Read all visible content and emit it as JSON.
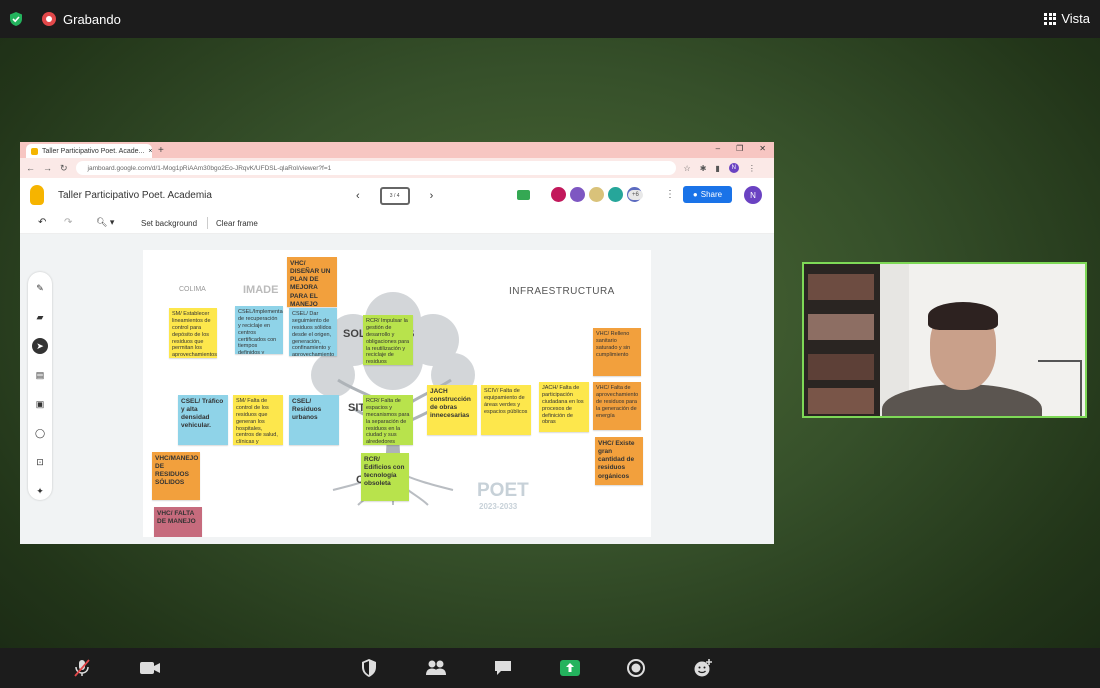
{
  "topbar": {
    "recording_label": "Grabando",
    "view_label": "Vista"
  },
  "browser": {
    "tab_title": "Taller Participativo Poet. Acade...",
    "tab_close": "×",
    "new_tab": "+",
    "url": "jamboard.google.com/d/1-Mog1pRiAAm30bgo2Eo-JRqvK/UFDSL-qlaRol/viewer?f=1",
    "win_min": "–",
    "win_max": "❐",
    "win_close": "✕"
  },
  "jamboard": {
    "title": "Taller Participativo Poet. Academia",
    "frame_label": "3 / 4",
    "more_collaborators": "+6",
    "share_label": "Share",
    "user_initial": "N",
    "set_background": "Set background",
    "clear_frame": "Clear frame"
  },
  "board": {
    "infraestructura": "INFRAESTRUCTURA",
    "soluciones_fragment": "SOLU",
    "soluciones_end": "S",
    "situacion_fragment": "SIT",
    "c_fragment": "C",
    "logo_colima": "COLIMA",
    "logo_imade": "IMADE",
    "poet": "POET",
    "poet_years": "2023-2033",
    "notes": [
      {
        "color": "o",
        "big": true,
        "text": "VHC/ DISEÑAR UN PLAN DE MEJORA PARA EL MANEJO"
      },
      {
        "color": "y",
        "big": false,
        "text": "SM/ Establecer lineamientos de control para depósito de los residuos que permitan los aprovechamientos de suelo"
      },
      {
        "color": "b",
        "big": false,
        "text": "CSEL/Implementación de recuperación y reciclaje en centros certificados con tiempos definidos y confinados con horarios y rutas"
      },
      {
        "color": "b",
        "big": false,
        "text": "CSEL/ Dar seguimiento de residuos sólidos desde el origen, generación, confinamiento y aprovechamiento en plantas de separación"
      },
      {
        "color": "g",
        "big": false,
        "text": "RCR/ Impulsar la gestión de desarrollo y obligaciones para la reutilización y reciclaje de residuos"
      },
      {
        "color": "o",
        "big": false,
        "text": "VHC/ Relleno sanitario saturado y sin cumplimiento"
      },
      {
        "color": "b",
        "big": true,
        "text": "CSEL/ Tráfico y alta densidad vehicular."
      },
      {
        "color": "y",
        "big": false,
        "text": "SM/ Falta de control de los residuos que generan los hospitales, centros de salud, clínicas y consultorios"
      },
      {
        "color": "b",
        "big": true,
        "text": "CSEL/ Residuos urbanos"
      },
      {
        "color": "g",
        "big": false,
        "text": "RCR/ Falta de espacios y mecanismos para la separación de residuos en la ciudad y sus alrededores"
      },
      {
        "color": "y",
        "big": true,
        "text": "JACH construcción de obras innecesarias"
      },
      {
        "color": "y",
        "big": false,
        "text": "SCIV/ Falta de equipamiento de áreas verdes y espacios públicos"
      },
      {
        "color": "y",
        "big": false,
        "text": "JACH/ Falta de participación ciudadana en los procesos de definición de obras"
      },
      {
        "color": "o",
        "big": false,
        "text": "VHC/ Falta de aprovechamiento de residuos para la generación de energía"
      },
      {
        "color": "o",
        "big": true,
        "text": "VHC/MANEJO DE RESIDUOS SÓLIDOS"
      },
      {
        "color": "g",
        "big": true,
        "text": "RCR/ Edificios con tecnología obsoleta"
      },
      {
        "color": "o",
        "big": true,
        "text": "VHC/ Existe gran cantidad de residuos orgánicos"
      },
      {
        "color": "p",
        "big": true,
        "text": "VHC/ FALTA DE MANEJO"
      }
    ]
  },
  "colors": {
    "topbar": "#1c1c1c",
    "camera_border": "#7ed957",
    "share_button": "#1a73e8",
    "share_screen_button": "#23b35d"
  }
}
